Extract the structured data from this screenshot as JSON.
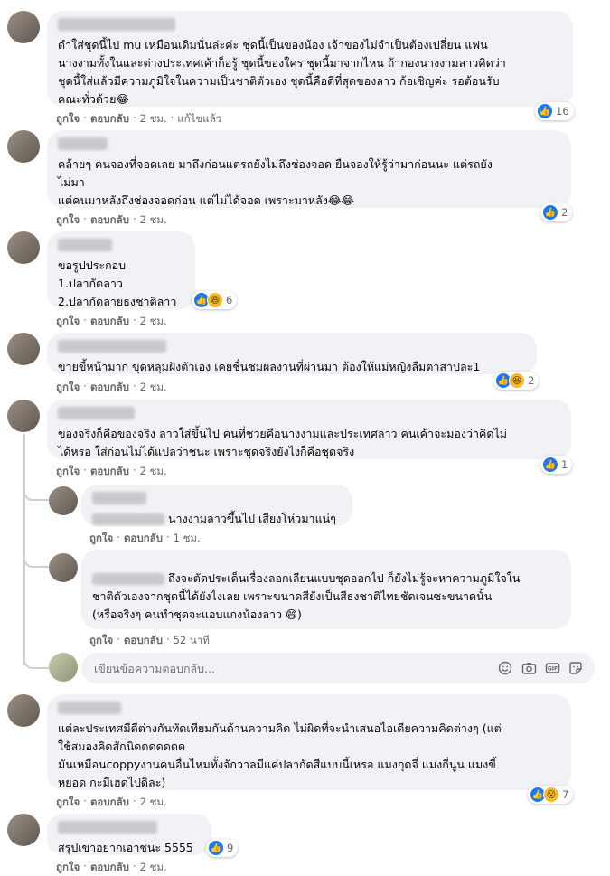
{
  "actions": {
    "like": "ถูกใจ",
    "reply": "ตอบกลับ",
    "sep": "·"
  },
  "comments": [
    {
      "text": "ดำใส่ชุดนี้ไป mu เหมือนเดิมนั่นล่ะค่ะ ชุดนี้เป็นของน้อง เจ้าของไม่จำเป็นต้องเปลี่ยน แฟน\nนางงามทั้งในและต่างประเทศเค้าก็อรู้ ชุดนี้ของใคร ชุดนี้มาจากไหน ถ้ากองนางงามลาวคิดว่า\nชุดนี้ใส่แล้วมีความภูมิใจในความเป็นชาติตัวเอง ชุดนี้คือดีที่สุดของลาว ก้อเชิญค่ะ รอต้อนรับ\nคณะทั่วด้วย😂",
      "time": "2 ชม.",
      "edited": "แก้ไขแล้ว",
      "reaction_count": "16"
    },
    {
      "text": "คล้ายๆ คนจองที่จอดเลย มาถึงก่อนแต่รถยังไม่ถึงช่องจอด ยืนจองให้รู้ว่ามาก่อนนะ แต่รถยัง\nไม่มา\nแต่คนมาหลังถึงช่องจอดก่อน แต่ไม่ได้จอด เพราะมาหลัง😂😂",
      "time": "2 ชม.",
      "reaction_count": "2"
    },
    {
      "text": "ขอรูปประกอบ\n1.ปลากัดลาว\n2.ปลากัดลายธงชาติลาว",
      "time": "2 ชม.",
      "reaction_count": "6"
    },
    {
      "text": "ขายขี้หน้ามาก ขุดหลุมฝังตัวเอง เคยชื่นชมผลงานที่ผ่านมา ต้องให้แม่หญิงลืมตาสาปละ1",
      "time": "2 ชม.",
      "reaction_count": "2"
    },
    {
      "text": "ของจริงก็คือของจริง ลาวใส่ขึ้นไป คนที่ชวยคือนางงามและประเทศลาว คนเค้าจะมองว่าคิดไม่\nได้หรอ ใส่ก่อนไม่ได้แปลว่าชนะ เพราะชุดจริงยังไงก็คือชุดจริง",
      "time": "2 ชม.",
      "reaction_count": "1"
    },
    {
      "text": "แต่ละประเทศมีดีต่างกันทัดเทียมกันด้านความคิด ไม่ผิดที่จะนำเสนอไอเดียความคิดต่างๆ (แต่\nใช้สมองคิดสักนิดดดดดดด\nมันเหมือนcoppyงานคนอื่นไหมทั้งจักวาลมีแค่ปลากัดสีแบบนี้เหรอ แมงกุดจี่ แมงกี่นูน แมงขี้\nหยอด กะมีเฮดไปดิละ)",
      "time": "2 ชม.",
      "reaction_count": "7"
    },
    {
      "text": "สรุปเขาอยากเอาชนะ 5555",
      "time": "2 ชม.",
      "reaction_count": "9"
    }
  ],
  "replies": [
    {
      "text": "นางงามลาวขึ้นไป เสียงโห่วมาแน่ๆ",
      "time": "1 ชม."
    },
    {
      "text": "ถึงจะตัดประเด็นเรื่องลอกเลียนแบบชุดออกไป ก็ยังไม่รู้จะหาความภูมิใจใน\nชาติตัวเองจากชุดนี้ได้ยังไงเลย เพราะขนาดสียังเป็นสีธงชาติไทยชัดเจนซะขนาดนั้น\n(หรือจริงๆ คนทำชุดจะแอบแกงน้องลาว 😄)",
      "time": "52 นาที"
    }
  ],
  "reply_input": {
    "placeholder": "เขียนข้อความตอบกลับ..."
  },
  "icons": {
    "emoji": "smiley-icon",
    "camera": "camera-icon",
    "gif": "gif-icon",
    "sticker": "sticker-icon"
  }
}
